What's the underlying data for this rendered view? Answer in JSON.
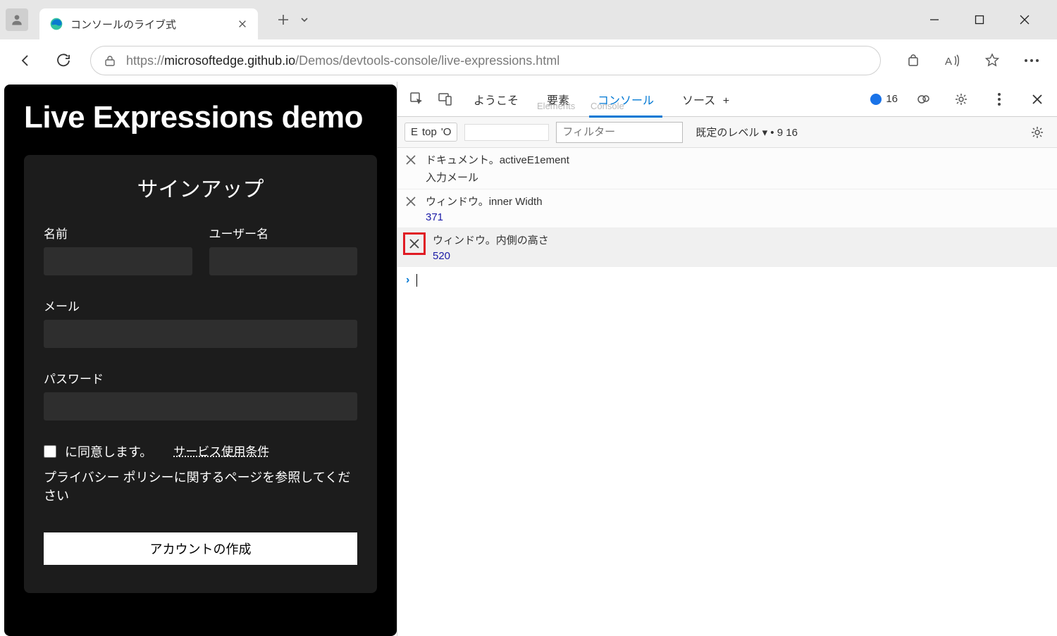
{
  "window": {
    "tab_title": "コンソールのライブ式",
    "url_prefix": "https://",
    "url_host": "microsoftedge.github.io",
    "url_path": "/Demos/devtools-console/live-expressions.html"
  },
  "page": {
    "heading": "Live Expressions demo",
    "form_title": "サインアップ",
    "fields": {
      "name_label": "名前",
      "username_label": "ユーザー名",
      "email_label": "メール",
      "password_label": "パスワード"
    },
    "agree_text": "に同意します。",
    "tos_link": "サービス使用条件",
    "privacy_text": "プライバシー ポリシーに関するページを参照してください",
    "submit_label": "アカウントの作成"
  },
  "devtools": {
    "tabs": {
      "welcome": "ようこそ",
      "elements_shadow": "Elements",
      "elements": "要素",
      "console_shadow": "Console",
      "console": "コンソール",
      "sources": "ソース",
      "more": "+"
    },
    "issues_count": "16",
    "subbar": {
      "context": "top",
      "context_prefix": "E",
      "context_suffix": "'O",
      "filter_placeholder": "フィルター",
      "levels_label": "既定のレベル",
      "issues_text": "9 16"
    },
    "live_expressions": [
      {
        "expr": "ドキュメント。activeE1ement",
        "value": "入力メール",
        "is_num": false
      },
      {
        "expr": "ウィンドウ。inner Width",
        "value": "371",
        "is_num": true
      },
      {
        "expr": "ウィンドウ。内側の高さ",
        "value": "520",
        "is_num": true
      }
    ]
  }
}
